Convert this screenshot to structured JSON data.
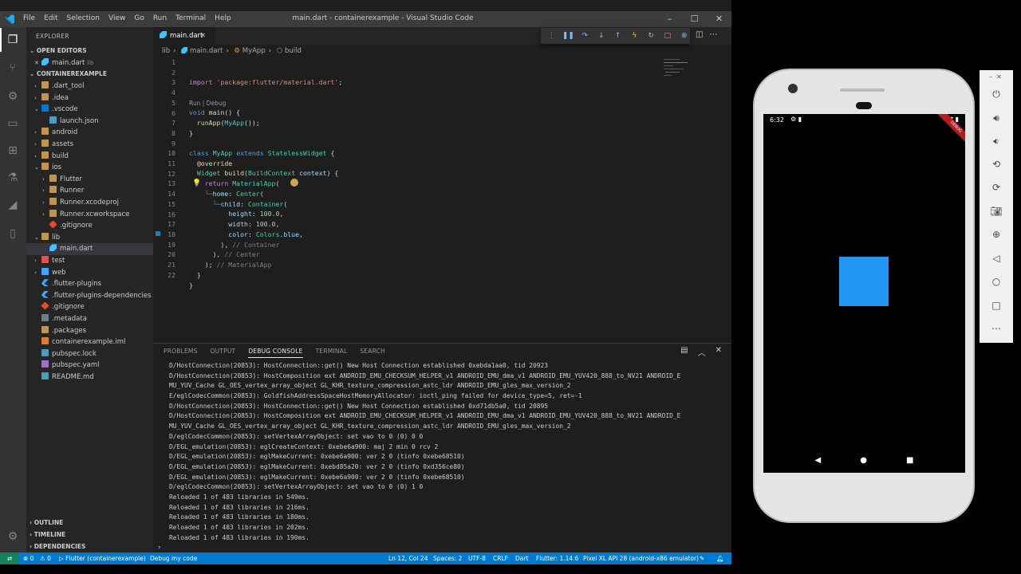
{
  "window": {
    "menu": [
      "File",
      "Edit",
      "Selection",
      "View",
      "Go",
      "Run",
      "Terminal",
      "Help"
    ],
    "title": "main.dart - containerexample - Visual Studio Code"
  },
  "sidebar": {
    "header": "EXPLORER",
    "open_editors_label": "OPEN EDITORS",
    "open_editor": {
      "name": "main.dart",
      "dir": "lib"
    },
    "project_label": "CONTAINEREXAMPLE",
    "tree": [
      {
        "label": ".dart_tool",
        "type": "folder",
        "depth": 1,
        "arrow": "›"
      },
      {
        "label": ".idea",
        "type": "folder",
        "depth": 1,
        "arrow": "›"
      },
      {
        "label": ".vscode",
        "type": "vsc",
        "depth": 1,
        "arrow": "⌄"
      },
      {
        "label": "launch.json",
        "type": "json",
        "depth": 2,
        "arrow": ""
      },
      {
        "label": "android",
        "type": "folder",
        "depth": 1,
        "arrow": "›"
      },
      {
        "label": "assets",
        "type": "folder",
        "depth": 1,
        "arrow": "›"
      },
      {
        "label": "build",
        "type": "folder",
        "depth": 1,
        "arrow": "›"
      },
      {
        "label": "ios",
        "type": "folder",
        "depth": 1,
        "arrow": "⌄"
      },
      {
        "label": "Flutter",
        "type": "folder",
        "depth": 2,
        "arrow": "›"
      },
      {
        "label": "Runner",
        "type": "folder",
        "depth": 2,
        "arrow": "›"
      },
      {
        "label": "Runner.xcodeproj",
        "type": "folder",
        "depth": 2,
        "arrow": "›"
      },
      {
        "label": "Runner.xcworkspace",
        "type": "folder",
        "depth": 2,
        "arrow": "›"
      },
      {
        "label": ".gitignore",
        "type": "git",
        "depth": 2,
        "arrow": ""
      },
      {
        "label": "lib",
        "type": "folder",
        "depth": 1,
        "arrow": "⌄"
      },
      {
        "label": "main.dart",
        "type": "dart",
        "depth": 2,
        "arrow": "",
        "selected": true
      },
      {
        "label": "test",
        "type": "test",
        "depth": 1,
        "arrow": "›"
      },
      {
        "label": "web",
        "type": "web",
        "depth": 1,
        "arrow": "›"
      },
      {
        "label": ".flutter-plugins",
        "type": "flutter",
        "depth": 1,
        "arrow": ""
      },
      {
        "label": ".flutter-plugins-dependencies",
        "type": "flutter",
        "depth": 1,
        "arrow": ""
      },
      {
        "label": ".gitignore",
        "type": "git",
        "depth": 1,
        "arrow": ""
      },
      {
        "label": ".metadata",
        "type": "file",
        "depth": 1,
        "arrow": ""
      },
      {
        "label": ".packages",
        "type": "folder",
        "depth": 1,
        "arrow": ""
      },
      {
        "label": "containerexample.iml",
        "type": "xml",
        "depth": 1,
        "arrow": ""
      },
      {
        "label": "pubspec.lock",
        "type": "json",
        "depth": 1,
        "arrow": ""
      },
      {
        "label": "pubspec.yaml",
        "type": "yaml",
        "depth": 1,
        "arrow": ""
      },
      {
        "label": "README.md",
        "type": "md",
        "depth": 1,
        "arrow": ""
      }
    ],
    "bottom_sections": [
      "OUTLINE",
      "TIMELINE",
      "DEPENDENCIES"
    ]
  },
  "editor": {
    "tab_label": "main.dart",
    "breadcrumb": [
      "lib",
      "main.dart",
      "MyApp",
      "build"
    ],
    "codelens": "Run | Debug",
    "line_numbers": [
      "1",
      "2",
      "3",
      "4",
      "5",
      "6",
      "7",
      "8",
      "9",
      "10",
      "11",
      "12",
      "13",
      "14",
      "15",
      "16",
      "17",
      "18",
      "19",
      "20",
      "21",
      "22"
    ]
  },
  "panel": {
    "tabs": [
      "PROBLEMS",
      "OUTPUT",
      "DEBUG CONSOLE",
      "TERMINAL",
      "SEARCH"
    ],
    "active_tab": "DEBUG CONSOLE",
    "log": [
      "D/HostConnection(20853): HostConnection::get() New Host Connection established 0xebda1aa0, tid 20923",
      "D/HostConnection(20853): HostComposition ext ANDROID_EMU_CHECKSUM_HELPER_v1 ANDROID_EMU_dma_v1 ANDROID_EMU_YUV420_888_to_NV21 ANDROID_E",
      "MU_YUV_Cache GL_OES_vertex_array_object GL_KHR_texture_compression_astc_ldr ANDROID_EMU_gles_max_version_2",
      "E/eglCodecCommon(20853): GoldfishAddressSpaceHostMemoryAllocator: ioctl_ping failed for device_type=5, ret=-1",
      "D/HostConnection(20853): HostConnection::get() New Host Connection established 0xd71db5a0, tid 20895",
      "D/HostConnection(20853): HostComposition ext ANDROID_EMU_CHECKSUM_HELPER_v1 ANDROID_EMU_dma_v1 ANDROID_EMU_YUV420_888_to_NV21 ANDROID_E",
      "MU_YUV_Cache GL_OES_vertex_array_object GL_KHR_texture_compression_astc_ldr ANDROID_EMU_gles_max_version_2",
      "D/eglCodecCommon(20853): setVertexArrayObject: set vao to 0 (0) 0 0",
      "D/EGL_emulation(20853): eglCreateContext: 0xebe6a900: maj 2 min 0 rcv 2",
      "D/EGL_emulation(20853): eglMakeCurrent: 0xebe6a900: ver 2 0 (tinfo 0xebe68510)",
      "D/EGL_emulation(20853): eglMakeCurrent: 0xebd85a20: ver 2 0 (tinfo 0xd356ce80)",
      "D/EGL_emulation(20853): eglMakeCurrent: 0xebe6a900: ver 2 0 (tinfo 0xebe68510)",
      "D/eglCodecCommon(20853): setVertexArrayObject: set vao to 0 (0) 1 0",
      "Reloaded 1 of 483 libraries in 549ms.",
      "Reloaded 1 of 483 libraries in 216ms.",
      "Reloaded 1 of 483 libraries in 180ms.",
      "Reloaded 1 of 483 libraries in 202ms.",
      "Reloaded 1 of 483 libraries in 190ms."
    ],
    "prompt": "›"
  },
  "statusbar": {
    "errors": "⊗ 0",
    "warnings": "⚠ 0",
    "debug_target": "▷ Flutter (containerexample)",
    "debug_mode": "Debug my code",
    "cursor": "Ln 12, Col 24",
    "spaces": "Spaces: 2",
    "encoding": "UTF-8",
    "eol": "CRLF",
    "language": "Dart",
    "flutter": "Flutter: 1.14.6",
    "device": "Pixel XL API 28 (android-x86 emulator)"
  },
  "emulator": {
    "time": "6:32",
    "debug_banner": "DEBUG",
    "box_color": "#2196f3"
  },
  "colors": {
    "accent": "#007acc",
    "keyword": "#c586c0",
    "type": "#4ec9b0",
    "string": "#ce9178"
  }
}
